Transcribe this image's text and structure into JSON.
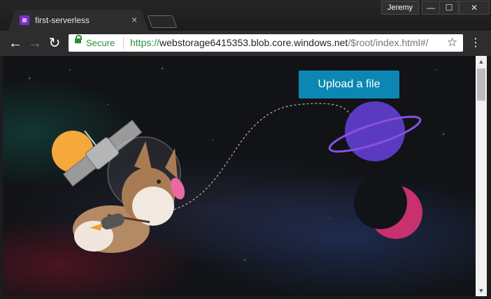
{
  "tab": {
    "title": "first-serverless",
    "close_glyph": "×",
    "favicon": "serverless-favicon-icon"
  },
  "window": {
    "user": "Jeremy",
    "minimize_glyph": "—",
    "maximize_glyph": "☐",
    "close_glyph": "✕"
  },
  "toolbar": {
    "back_glyph": "←",
    "forward_glyph": "→",
    "reload_glyph": "↻",
    "menu_glyph": "⋮",
    "star_glyph": "☆"
  },
  "omnibox": {
    "secure_label": "Secure",
    "url_scheme": "https://",
    "url_host": "webstorage6415353.blob.core.windows.net",
    "url_path": "/$root/index.html#/"
  },
  "page": {
    "upload_label": "Upload a file",
    "illustration": "corgi-astronaut-space-scene",
    "colors": {
      "button": "#0c87b3",
      "planet": "#5a3bbf",
      "moon": "#c8306e",
      "sun": "#f4a93a"
    }
  },
  "scrollbar": {
    "up_glyph": "▲",
    "down_glyph": "▼"
  }
}
